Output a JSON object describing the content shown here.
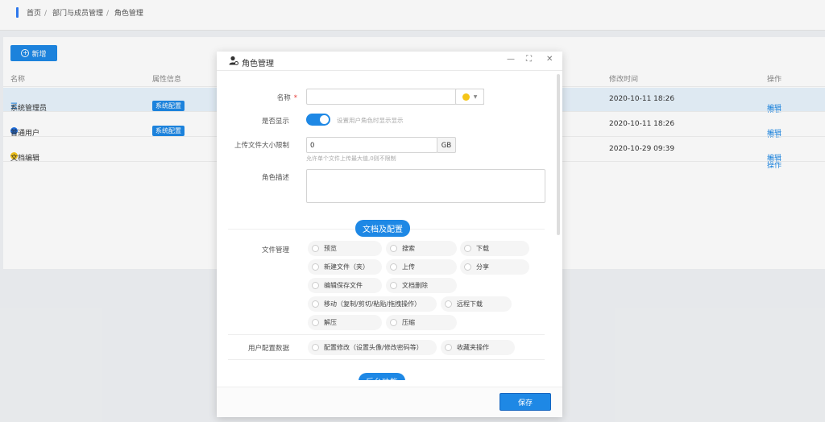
{
  "breadcrumb": [
    "首页",
    "部门与成员管理",
    "角色管理"
  ],
  "toolbar": {
    "add_label": "新增"
  },
  "table": {
    "headers": {
      "name": "名称",
      "attr": "属性信息",
      "time": "修改时间",
      "op": "操作"
    },
    "rows": [
      {
        "name": "系统管理员",
        "tag": "系统配置",
        "time": "2020-10-11 18:26",
        "edit": "编辑",
        "more": "操作"
      },
      {
        "name": "普通用户",
        "tag": "系统配置",
        "time": "2020-10-11 18:26",
        "edit": "编辑",
        "more": "操作"
      },
      {
        "name": "文档编辑",
        "tag": "",
        "time": "2020-10-29 09:39",
        "edit": "编辑",
        "more": "操作"
      }
    ]
  },
  "dialog": {
    "title": "角色管理",
    "name_label": "名称",
    "name_value": "",
    "show_label": "是否显示",
    "show_hint": "设置用户角色时显示显示",
    "show_on": true,
    "upload_label": "上传文件大小限制",
    "upload_value": "0",
    "upload_unit": "GB",
    "upload_hint": "允许单个文件上传最大值,0则不限制",
    "desc_label": "角色描述",
    "section1": "文档及配置",
    "file_mgmt_label": "文件管理",
    "file_options": [
      "预览",
      "搜索",
      "下载",
      "新建文件（夹）",
      "上传",
      "分享",
      "编辑保存文件",
      "文档删除",
      "移动（复制/剪切/粘贴/拖拽操作）",
      "远程下载",
      "解压",
      "压缩"
    ],
    "user_cfg_label": "用户配置数据",
    "user_options": [
      "配置修改（设置头像/修改密码等）",
      "收藏夹操作"
    ],
    "section2": "后台功能",
    "save_label": "保存"
  },
  "colors": {
    "accent": "#1e88e5",
    "admin_dot": "#1e88e5",
    "user_dot": "#1e6ee0",
    "editor_dot": "#f5c518",
    "required": "#e53935"
  }
}
